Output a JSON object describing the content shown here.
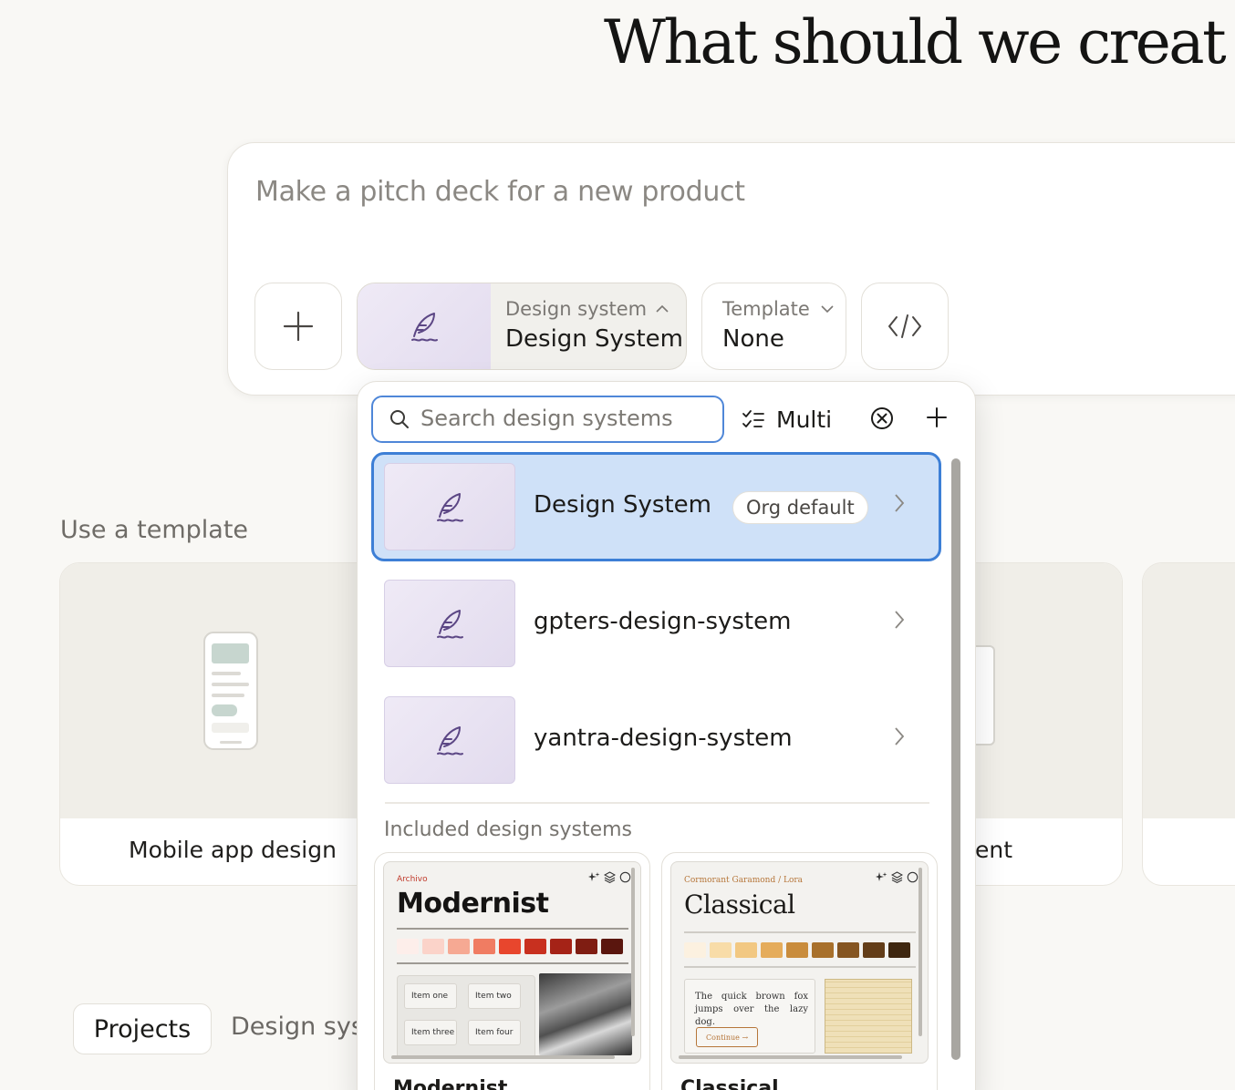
{
  "headline": "What should we creat",
  "prompt": {
    "placeholder": "Make a pitch deck for a new product"
  },
  "toolbar": {
    "design_system_caption": "Design system",
    "design_system_value": "Design System",
    "template_caption": "Template",
    "template_value": "None"
  },
  "section": {
    "use_template": "Use a template"
  },
  "templates": [
    {
      "label": "Mobile app design"
    },
    {
      "label": "ent"
    }
  ],
  "tabs": {
    "projects": "Projects",
    "design_systems": "Design sys"
  },
  "dropdown": {
    "search_placeholder": "Search design systems",
    "multi_label": "Multi",
    "items": [
      {
        "name": "Design System",
        "badge": "Org default",
        "selected": true
      },
      {
        "name": "gpters-design-system"
      },
      {
        "name": "yantra-design-system"
      }
    ],
    "included_label": "Included design systems",
    "included": [
      {
        "caption": "Archivo",
        "title": "Modernist",
        "items": [
          "Item one",
          "Item two",
          "Item three",
          "Item four"
        ],
        "swatches": [
          "#fdeeea",
          "#fbd3c9",
          "#f6a993",
          "#f07c62",
          "#e8462d",
          "#c8301f",
          "#a52317",
          "#7f1d12",
          "#5a160e"
        ],
        "name": "Modernist"
      },
      {
        "caption": "Cormorant Garamond / Lora",
        "title": "Classical",
        "text": "The quick brown fox jumps over the lazy dog.",
        "button": "Continue →",
        "swatches": [
          "#fcf1e0",
          "#f8dca8",
          "#f2c882",
          "#e5ac5b",
          "#c98c3c",
          "#a8702b",
          "#855521",
          "#633d18",
          "#3f2710"
        ],
        "name": "Classical"
      }
    ]
  },
  "colors": {
    "accent": "#3d7fd6",
    "selected_bg": "#cfe1f8",
    "background": "#f9f8f5"
  }
}
